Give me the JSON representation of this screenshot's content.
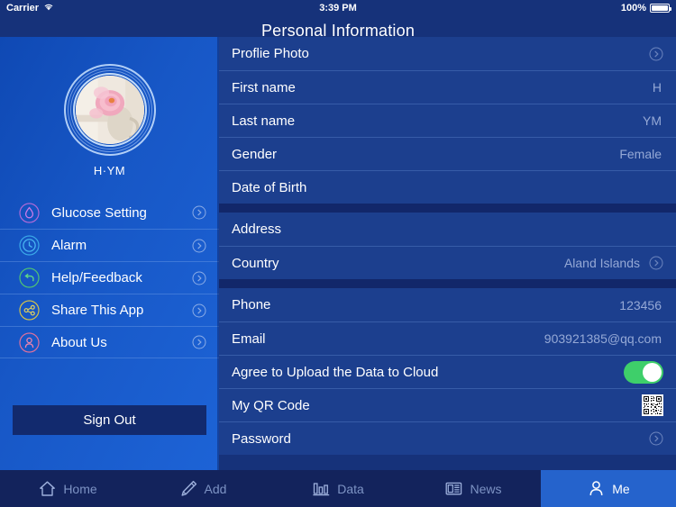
{
  "status_bar": {
    "carrier": "Carrier",
    "wifi_icon": "wifi-icon",
    "time": "3:39 PM",
    "battery_percent": "100%",
    "battery_icon": "battery-full-icon"
  },
  "nav": {
    "title": "Personal Information"
  },
  "sidebar": {
    "avatar": {
      "icon": "avatar-photo",
      "name": "H·YM"
    },
    "items": [
      {
        "label": "Glucose Setting",
        "icon": "droplet-icon",
        "icon_color": "#b06ad8",
        "chevron": "chevron-right-circle-icon"
      },
      {
        "label": "Alarm",
        "icon": "clock-icon",
        "icon_color": "#3aa8e8",
        "chevron": "chevron-right-circle-icon"
      },
      {
        "label": "Help/Feedback",
        "icon": "undo-icon",
        "icon_color": "#4fc274",
        "chevron": "chevron-right-circle-icon"
      },
      {
        "label": "Share This App",
        "icon": "share-icon",
        "icon_color": "#d4c24a",
        "chevron": "chevron-right-circle-icon"
      },
      {
        "label": "About Us",
        "icon": "person-icon",
        "icon_color": "#e0719c",
        "chevron": "chevron-right-circle-icon"
      }
    ],
    "sign_out_label": "Sign Out"
  },
  "form": {
    "sections": [
      {
        "rows": [
          {
            "label": "Proflie Photo",
            "value": "",
            "accessory": "chevron"
          },
          {
            "label": "First name",
            "value": "H",
            "accessory": "none"
          },
          {
            "label": "Last name",
            "value": "YM",
            "accessory": "none"
          },
          {
            "label": "Gender",
            "value": "Female",
            "accessory": "none"
          },
          {
            "label": "Date of Birth",
            "value": "",
            "accessory": "none"
          }
        ]
      },
      {
        "rows": [
          {
            "label": "Address",
            "value": "",
            "accessory": "none"
          },
          {
            "label": "Country",
            "value": "Aland Islands",
            "accessory": "chevron"
          }
        ]
      },
      {
        "rows": [
          {
            "label": "Phone",
            "value": "123456",
            "accessory": "none"
          },
          {
            "label": "Email",
            "value": "903921385@qq.com",
            "accessory": "none"
          },
          {
            "label": "Agree to Upload the Data to Cloud",
            "value": "",
            "accessory": "toggle",
            "toggle_on": true
          },
          {
            "label": "My QR Code",
            "value": "",
            "accessory": "qr"
          },
          {
            "label": "Password",
            "value": "",
            "accessory": "chevron"
          }
        ]
      }
    ]
  },
  "tabbar": {
    "tabs": [
      {
        "label": "Home",
        "icon": "home-icon",
        "active": false
      },
      {
        "label": "Add",
        "icon": "pencil-icon",
        "active": false
      },
      {
        "label": "Data",
        "icon": "barchart-icon",
        "active": false
      },
      {
        "label": "News",
        "icon": "newspaper-icon",
        "active": false
      },
      {
        "label": "Me",
        "icon": "person-icon",
        "active": true
      }
    ]
  },
  "colors": {
    "nav_bg": "#16327a",
    "sidebar_blue": "#1757c6",
    "panel_row": "#1c3f8e",
    "section_gap": "#12276a",
    "tabbar_bg": "#13235c",
    "tab_active_bg": "#2563cc",
    "toggle_on": "#3ecf6a",
    "signout_bg": "#122a6e",
    "value_text": "#95a9d6"
  }
}
